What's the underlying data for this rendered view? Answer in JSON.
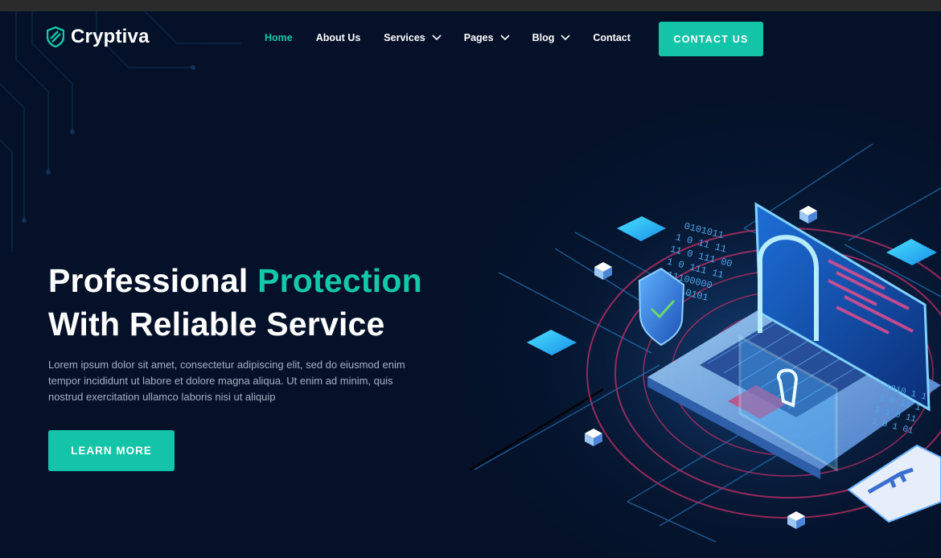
{
  "brand": {
    "name": "Cryptiva",
    "logo_icon": "shield-icon"
  },
  "nav": {
    "items": [
      {
        "label": "Home",
        "active": true,
        "dropdown": false
      },
      {
        "label": "About Us",
        "active": false,
        "dropdown": false
      },
      {
        "label": "Services",
        "active": false,
        "dropdown": true
      },
      {
        "label": "Pages",
        "active": false,
        "dropdown": true
      },
      {
        "label": "Blog",
        "active": false,
        "dropdown": true
      },
      {
        "label": "Contact",
        "active": false,
        "dropdown": false
      }
    ],
    "cta_label": "CONTACT US"
  },
  "hero": {
    "headline_part1": "Professional ",
    "headline_accent": "Protection",
    "headline_part2": "With Reliable Service",
    "description": "Lorem ipsum dolor sit amet, consectetur adipiscing elit, sed do eiusmod enim tempor incididunt ut labore et dolore magna aliqua. Ut enim ad minim, quis nostrud exercitation ullamco laboris nisi ut aliquip",
    "button_label": "LEARN MORE"
  },
  "illustration": {
    "binary_1": [
      "0101011",
      "1 0  11  11",
      "11 0  111  00",
      "1 0  111  11",
      "11100000",
      "1010101",
      "0101010"
    ],
    "binary_2": [
      "1010 1 1",
      "1 0  11 1",
      "1 1  0 11",
      "1 0  1  01"
    ]
  },
  "colors": {
    "background": "#041129",
    "accent": "#14c8aa",
    "button": "#13c4a8",
    "text": "#ffffff",
    "muted_text": "#a8b1c4"
  }
}
